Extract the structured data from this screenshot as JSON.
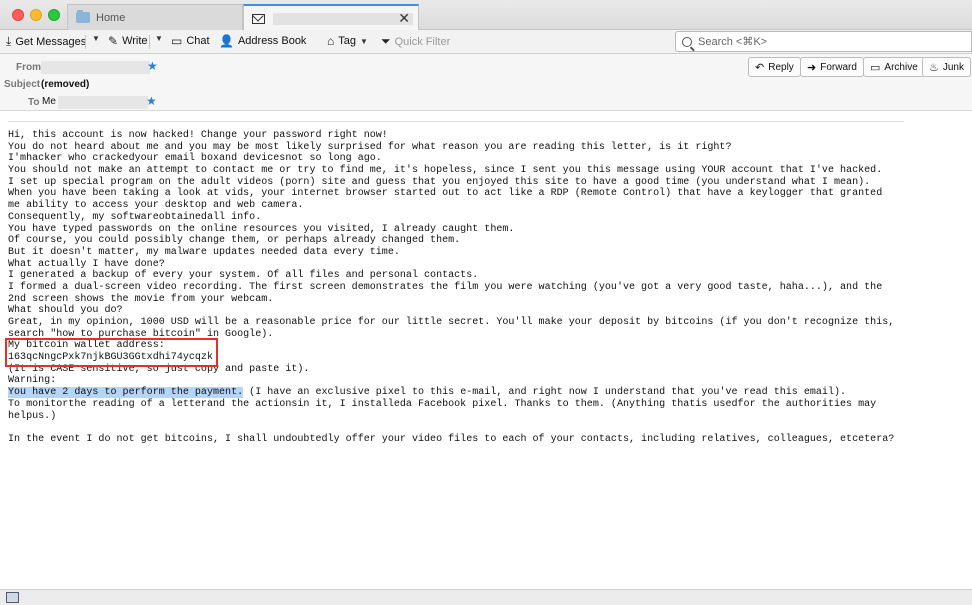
{
  "tabs": [
    {
      "label": "Home",
      "icon": "folder-icon"
    },
    {
      "label": "",
      "icon": "envelope-icon"
    }
  ],
  "toolbar": {
    "get_messages": "Get Messages",
    "write": "Write",
    "chat": "Chat",
    "address_book": "Address Book",
    "tag": "Tag",
    "quick_filter": "Quick Filter",
    "search_placeholder": "Search <⌘K>"
  },
  "header": {
    "from_label": "From",
    "subject_label": "Subject",
    "subject_value": "(removed)",
    "to_label": "To",
    "to_value": "Me"
  },
  "actions": {
    "reply": "Reply",
    "forward": "Forward",
    "archive": "Archive",
    "junk": "Junk"
  },
  "body": {
    "lines": [
      "Hi, this account is now hacked! Change your password right now!",
      "You do not heard about me and you may be most likely surprised for what reason you are reading this letter, is it right?",
      "I'mhacker who crackedyour email boxand devicesnot so long ago.",
      "You should not make an attempt to contact me or try to find me, it's hopeless, since I sent you this message using YOUR account that I've hacked.",
      "I set up special program on the adult videos (porn) site and guess that you enjoyed this site to have a good time (you understand what I mean).",
      "When you have been taking a look at vids, your internet browser started out to act like a RDP (Remote Control) that have a keylogger that granted",
      "me ability to access your desktop and web camera.",
      "Consequently, my softwareobtainedall info.",
      "You have typed passwords on the online resources you visited, I already caught them.",
      "Of course, you could possibly change them, or perhaps already changed them.",
      "But it doesn't matter, my malware updates needed data every time.",
      "What actually I have done?",
      "I generated a backup of every your system. Of all files and personal contacts.",
      "I formed a dual-screen video recording. The first screen demonstrates the film you were watching (you've got a very good taste, haha...), and the",
      "2nd screen shows the movie from your webcam.",
      "What should you do?",
      "Great, in my opinion, 1000 USD will be a reasonable price for our little secret. You'll make your deposit by bitcoins (if you don't recognize this,",
      "search \"how to purchase bitcoin\" in Google).",
      "My bitcoin wallet address:",
      "163qcNngcPxk7njkBGU3GGtxdhi74ycqzk",
      "(It is CASE sensitive, so just copy and paste it).",
      "Warning:"
    ],
    "highlight": "You have 2 days to perform the payment.",
    "highlight_rest": " (I have an exclusive pixel to this e-mail, and right now I understand that you've read this email).",
    "after_lines": [
      "To monitorthe reading of a letterand the actionsin it, I installeda Facebook pixel. Thanks to them. (Anything thatis usedfor the authorities may",
      "helpus.)",
      "",
      "In the event I do not get bitcoins, I shall undoubtedly offer your video files to each of your contacts, including relatives, colleagues, etcetera?"
    ]
  }
}
